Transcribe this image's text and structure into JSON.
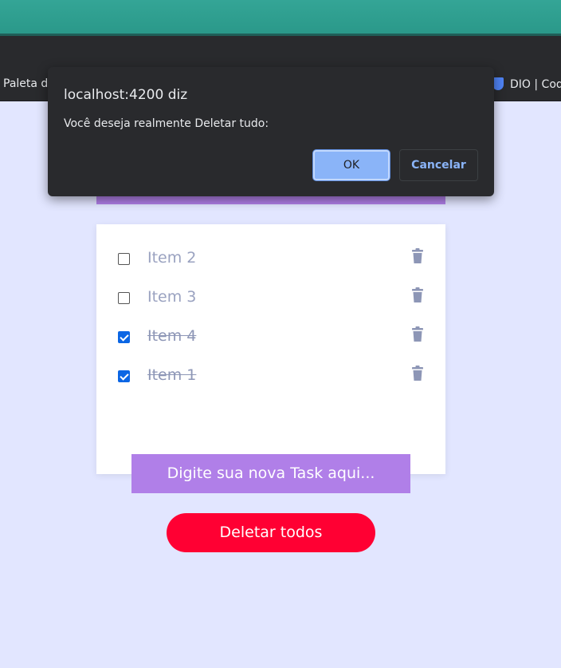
{
  "browser": {
    "bookmarks_left": "Paleta de",
    "bookmarks_right": "DIO | Cod"
  },
  "dialog": {
    "title": "localhost:4200 diz",
    "message": "Você deseja realmente Deletar tudo:",
    "ok_label": "OK",
    "cancel_label": "Cancelar"
  },
  "tasks": [
    {
      "label": "Item 2",
      "checked": false
    },
    {
      "label": "Item 3",
      "checked": false
    },
    {
      "label": "Item 4",
      "checked": true
    },
    {
      "label": "Item 1",
      "checked": true
    }
  ],
  "new_task": {
    "placeholder": "Digite sua nova Task aqui..."
  },
  "delete_all": {
    "label": "Deletar todos"
  },
  "icons": {
    "delete": "trash-icon"
  },
  "colors": {
    "accent_purple": "#b07fe8",
    "danger_red": "#ff0033",
    "checkbox_blue": "#0b66e4",
    "page_bg": "#e2e6ff"
  }
}
